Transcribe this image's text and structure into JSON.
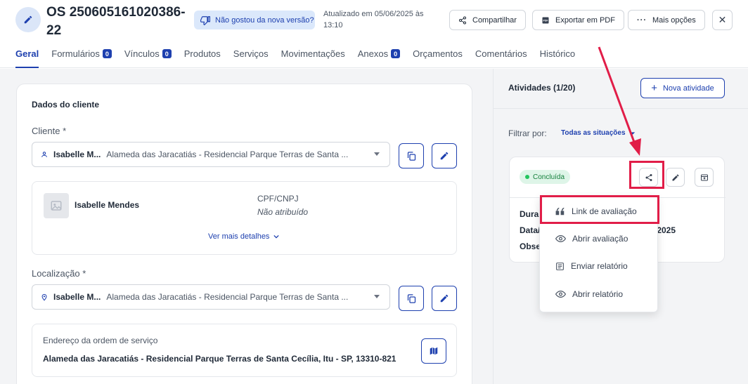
{
  "header": {
    "title": "OS 250605161020386-22",
    "feedback_label": "Não gostou da nova versão?",
    "updated_text": "Atualizado em 05/06/2025 às 13:10",
    "share_label": "Compartilhar",
    "export_label": "Exportar em PDF",
    "more_label": "Mais opções",
    "close_symbol": "✕"
  },
  "tabs": [
    {
      "label": "Geral",
      "badge": null,
      "active": true
    },
    {
      "label": "Formulários",
      "badge": "0"
    },
    {
      "label": "Vínculos",
      "badge": "0"
    },
    {
      "label": "Produtos",
      "badge": null
    },
    {
      "label": "Serviços",
      "badge": null
    },
    {
      "label": "Movimentações",
      "badge": null
    },
    {
      "label": "Anexos",
      "badge": "0"
    },
    {
      "label": "Orçamentos",
      "badge": null
    },
    {
      "label": "Comentários",
      "badge": null
    },
    {
      "label": "Histórico",
      "badge": null
    }
  ],
  "client_section": {
    "title": "Dados do cliente",
    "client_label": "Cliente *",
    "client_name_short": "Isabelle M...",
    "client_address": "Alameda das Jaracatiás - Residencial Parque Terras de Santa ...",
    "client_name": "Isabelle Mendes",
    "cpf_label": "CPF/CNPJ",
    "cpf_value": "Não atribuído",
    "more_details": "Ver mais detalhes",
    "location_label": "Localização *",
    "location_name_short": "Isabelle M...",
    "location_address": "Alameda das Jaracatiás - Residencial Parque Terras de Santa ...",
    "os_address_label": "Endereço da ordem de serviço",
    "os_address_value": "Alameda das Jaracatiás - Residencial Parque Terras de Santa Cecília, Itu - SP, 13310-821"
  },
  "activities": {
    "title": "Atividades (1/20)",
    "new_label": "Nova atividade",
    "filter_label": "Filtrar por:",
    "filter_value": "Todas as situações",
    "card": {
      "status": "Concluída",
      "line1": "Dura",
      "line2": "Data/",
      "line2_tail": "/2025",
      "line3": "Obse"
    },
    "menu": [
      {
        "label": "Link de avaliação",
        "icon": "quote-icon"
      },
      {
        "label": "Abrir avaliação",
        "icon": "eye-icon"
      },
      {
        "label": "Enviar relatório",
        "icon": "document-icon"
      },
      {
        "label": "Abrir relatório",
        "icon": "eye-icon"
      }
    ]
  },
  "colors": {
    "accent": "#1e40af",
    "highlight": "#e11d48",
    "success": "#22c55e"
  }
}
